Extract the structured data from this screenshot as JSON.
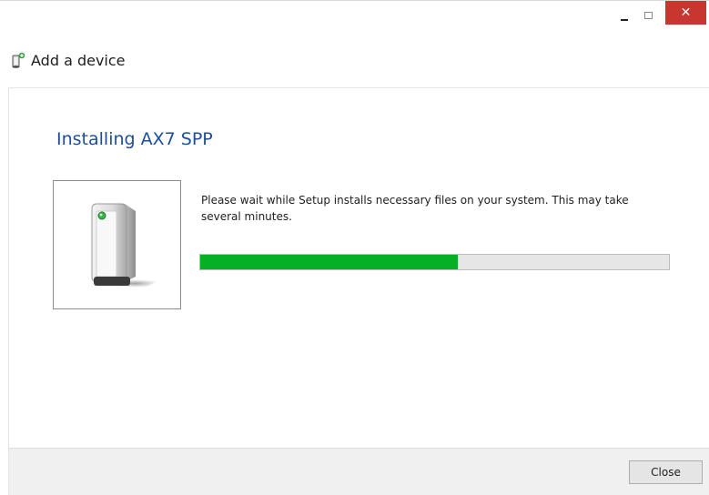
{
  "window": {
    "title": "Add a device",
    "controls": {
      "minimize_icon": "minimize-icon",
      "maximize_icon": "maximize-icon",
      "close_glyph": "✕",
      "close_color": "#c7362f"
    }
  },
  "main": {
    "heading": "Installing AX7 SPP",
    "heading_color": "#1e4e9a",
    "device_icon": "device-tower-icon",
    "message": "Please wait while Setup installs necessary files on your system. This may take several minutes.",
    "progress": {
      "fraction": 0.55,
      "fill_color": "#06b025"
    }
  },
  "footer": {
    "close_label": "Close"
  }
}
